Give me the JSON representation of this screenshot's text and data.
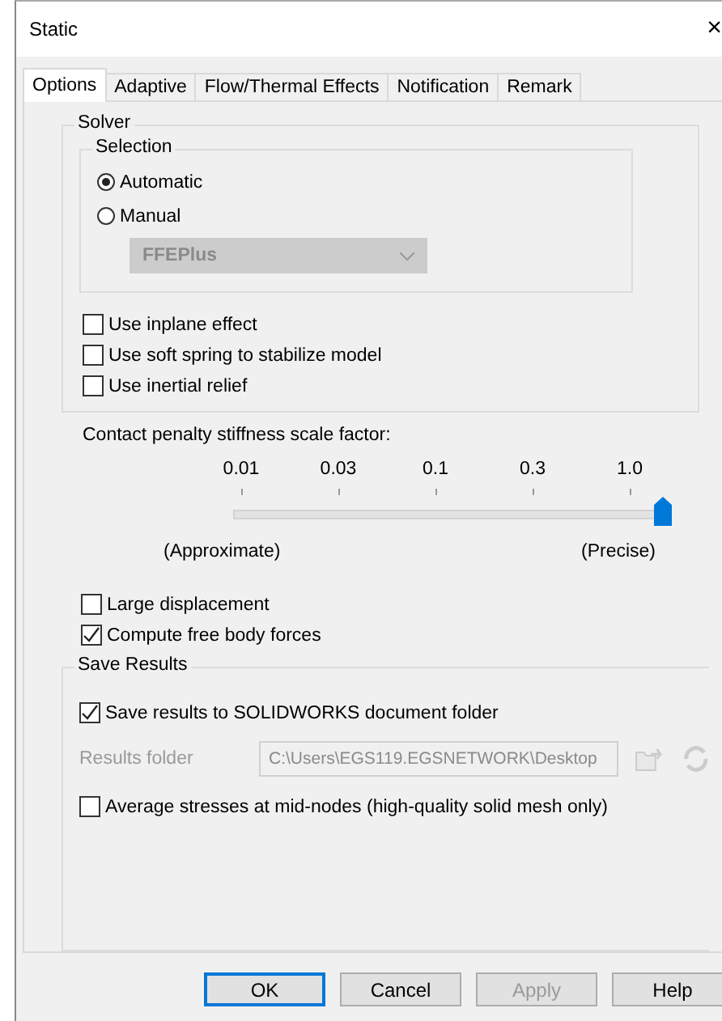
{
  "window": {
    "title": "Static",
    "close": "×"
  },
  "tabs": [
    {
      "label": "Options",
      "selected": true
    },
    {
      "label": "Adaptive",
      "selected": false
    },
    {
      "label": "Flow/Thermal Effects",
      "selected": false
    },
    {
      "label": "Notification",
      "selected": false
    },
    {
      "label": "Remark",
      "selected": false
    }
  ],
  "solver": {
    "title": "Solver",
    "selection": {
      "title": "Selection",
      "options": [
        {
          "label": "Automatic",
          "selected": true
        },
        {
          "label": "Manual",
          "selected": false
        }
      ],
      "dropdown": {
        "value": "FFEPlus",
        "disabled": true
      }
    },
    "checks": [
      {
        "label": "Use inplane effect",
        "checked": false
      },
      {
        "label": "Use soft spring to stabilize model",
        "checked": false
      },
      {
        "label": "Use inertial relief",
        "checked": false
      }
    ]
  },
  "contact": {
    "label": "Contact penalty stiffness scale factor:",
    "ticks": [
      "0.01",
      "0.03",
      "0.1",
      "0.3",
      "1.0"
    ],
    "level": 1,
    "min_label": "(Approximate)",
    "max_label": "(Precise)"
  },
  "options": [
    {
      "label": "Large displacement",
      "checked": false
    },
    {
      "label": "Compute free body forces",
      "checked": true
    }
  ],
  "save_results": {
    "title": "Save Results",
    "save_check": {
      "label": "Save results to SOLIDWORKS document folder",
      "checked": true
    },
    "folder": {
      "label": "Results folder",
      "value": "C:\\Users\\EGS119.EGSNETWORK\\Desktop",
      "disabled": true
    },
    "average_check": {
      "label": "Average stresses at mid-nodes (high-quality solid mesh only)",
      "checked": false
    }
  },
  "buttons": [
    {
      "label": "OK",
      "kind": "default"
    },
    {
      "label": "Cancel",
      "kind": "normal"
    },
    {
      "label": "Apply",
      "kind": "disabled"
    },
    {
      "label": "Help",
      "kind": "normal"
    }
  ]
}
